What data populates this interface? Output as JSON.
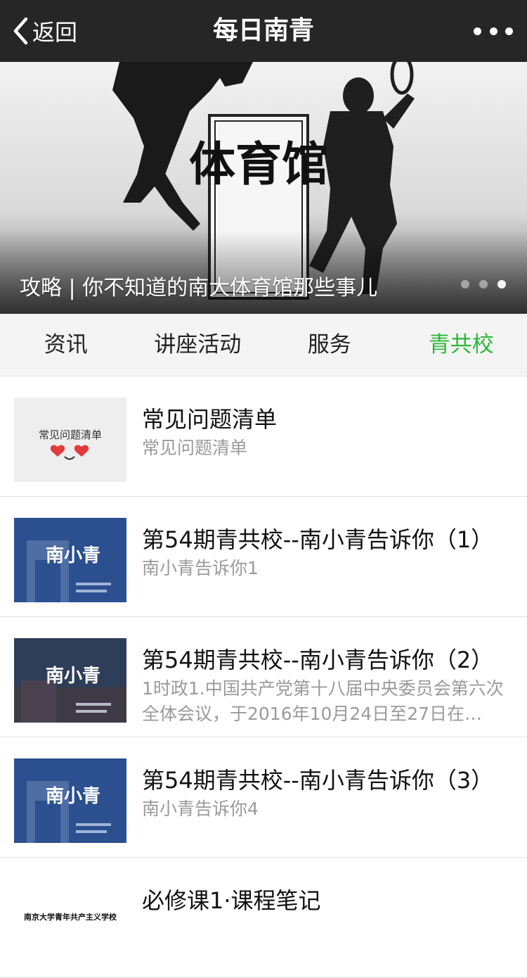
{
  "navbar": {
    "back_label": "返回",
    "title": "每日南青",
    "more_icon": "more-dots-icon"
  },
  "banner": {
    "image_text": "体育馆",
    "caption": "攻略 | 你不知道的南大体育馆那些事儿",
    "dots": 3,
    "active_dot": 2
  },
  "tabs": [
    {
      "label": "资讯",
      "active": false
    },
    {
      "label": "讲座活动",
      "active": false
    },
    {
      "label": "服务",
      "active": false
    },
    {
      "label": "青共校",
      "active": true
    }
  ],
  "articles": [
    {
      "title": "常见问题清单",
      "summary": "常见问题清单",
      "thumb_text": "常见问题清单"
    },
    {
      "title": "第54期青共校--南小青告诉你（1）",
      "summary": "南小青告诉你1",
      "thumb_text": "南小青"
    },
    {
      "title": "第54期青共校--南小青告诉你（2）",
      "summary": "1时政1.中国共产党第十八届中央委员会第六次全体会议，于2016年10月24日至27日在…",
      "thumb_text": "南小青"
    },
    {
      "title": "第54期青共校--南小青告诉你（3）",
      "summary": "南小青告诉你4",
      "thumb_text": "南小青"
    },
    {
      "title": "必修课1·课程笔记",
      "summary": "",
      "thumb_text": "南京大学青年共产主义学校"
    }
  ],
  "colors": {
    "navbar_bg": "#262626",
    "active_tab": "#2db837",
    "muted_text": "#9a9a9a",
    "thumb_blue": "#2b4f8f"
  }
}
